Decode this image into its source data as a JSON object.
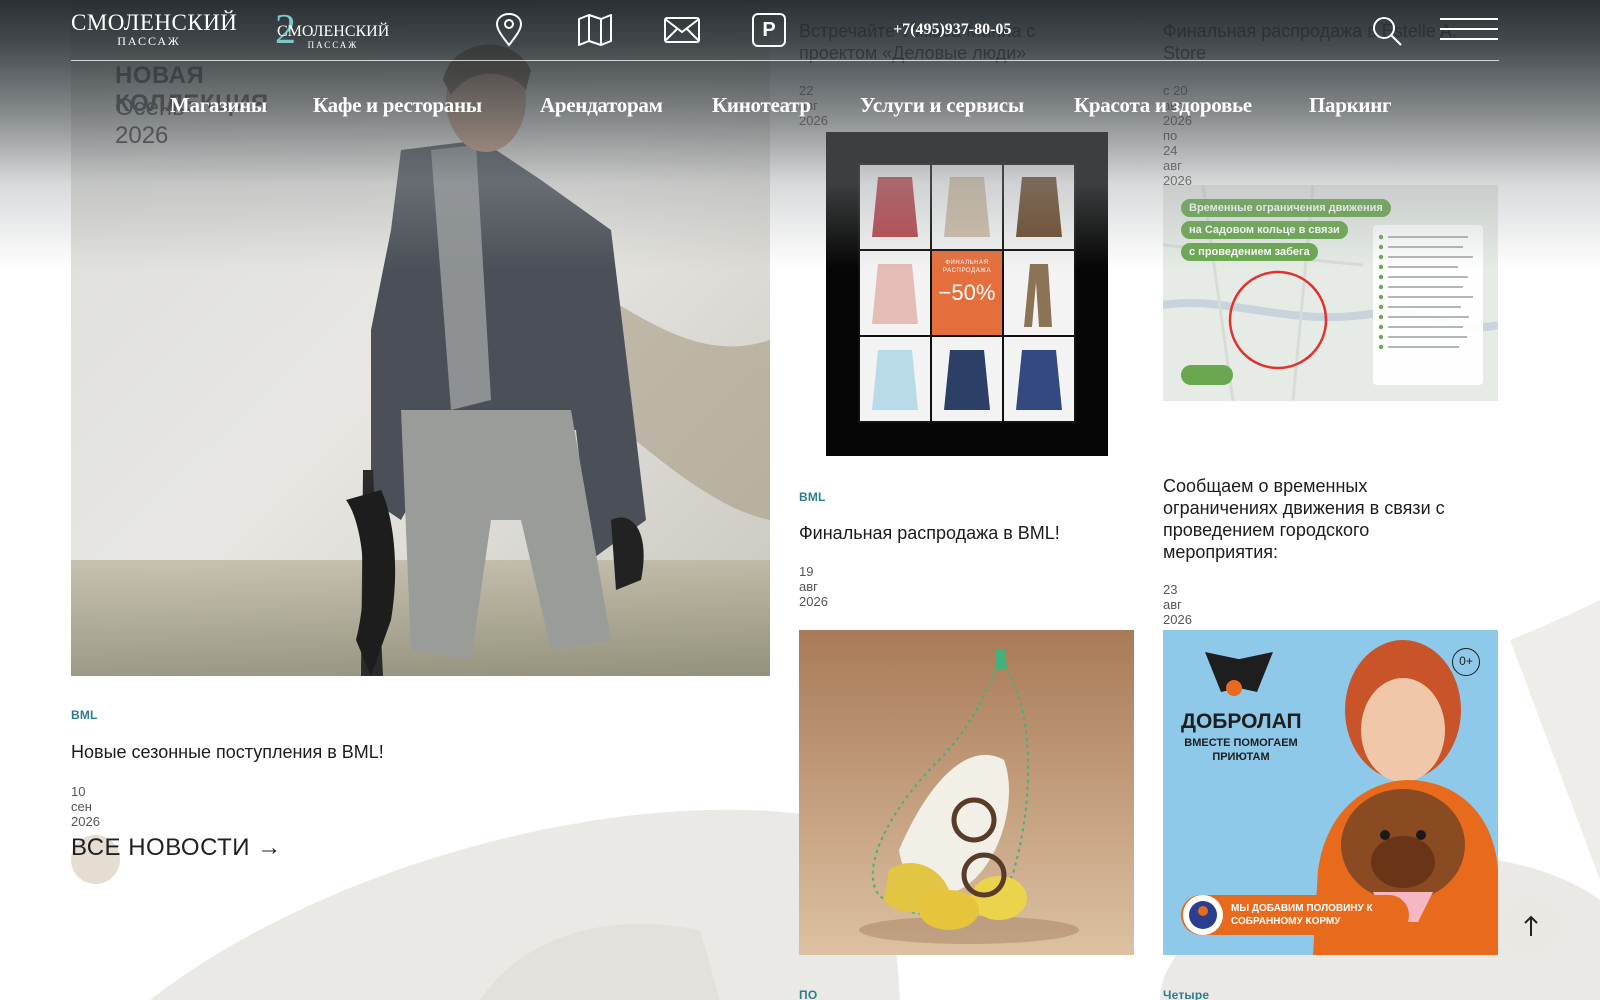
{
  "header": {
    "logo1": {
      "main": "СМОЛЕНСКИЙ",
      "sub": "ПАССАЖ"
    },
    "logo2": {
      "num": "2",
      "main": "СМОЛЕНСКИЙ",
      "sub": "ПАССАЖ"
    },
    "icons": [
      "location-pin-icon",
      "map-icon",
      "mail-icon",
      "parking-icon",
      "search-icon",
      "menu-icon"
    ],
    "parking_label": "P",
    "phone": "+7(495)937-80-05"
  },
  "nav": [
    "Магазины",
    "Кафе и рестораны",
    "Арендаторам",
    "Кинотеатр",
    "Услуги и сервисы",
    "Красота и здоровье",
    "Паркинг"
  ],
  "feature": {
    "overlay_title": "НОВАЯ КОЛЛЕКЦИЯ",
    "overlay_subtitle": "Осень 2026",
    "tag": "BML",
    "title": "Новые сезонные поступления в BML!",
    "date": "10 сен 2026"
  },
  "top_row": [
    {
      "title": "Встречайте Томаса Манна с проектом «Деловые люди»",
      "date": "22 авг 2026"
    },
    {
      "title": "Финальная распродажа в Estelle A. Store",
      "date": "с 20 авг 2026 по 24 авг 2026"
    }
  ],
  "middle_row": [
    {
      "tag": "BML",
      "title": "Финальная распродажа в BML!",
      "date": "19 авг 2026",
      "poster": {
        "line1": "ФИНАЛЬНАЯ",
        "line2": "РАСПРОДАЖА",
        "discount": "−50%"
      }
    },
    {
      "tag": "",
      "title": "Сообщаем о временных ограничениях движения в связи с проведением городского мероприятия:",
      "date": "23 авг 2026",
      "map_labels": [
        "Временные ограничения движения",
        "на Садовом кольце в связи",
        "с проведением забега"
      ]
    }
  ],
  "bottom_row": [
    {
      "tag": "ПО ONE"
    },
    {
      "tag": "Четыре Лапы",
      "poster": {
        "brand": "ДОБРОЛАП",
        "slogan": "ВМЕСТЕ ПОМОГАЕМ ПРИЮТАМ",
        "age": "0+",
        "offer": "МЫ ДОБАВИМ ПОЛОВИНУ К СОБРАННОМУ КОРМУ"
      }
    }
  ],
  "all_news": "ВСЕ НОВОСТИ →",
  "colors": {
    "tag": "#2e7d8f",
    "accent_teal": "#7fc6c8",
    "map_green": "#6aa84f",
    "poster_orange": "#e86a1c",
    "poster_blue": "#8ec9ea"
  }
}
